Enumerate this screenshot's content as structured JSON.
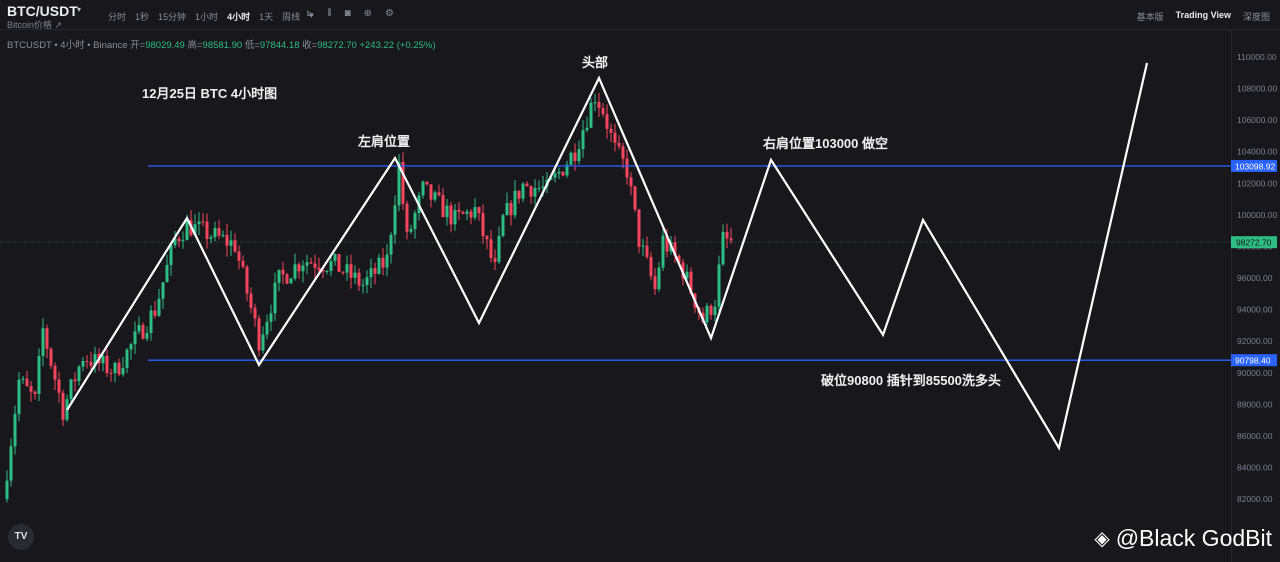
{
  "header": {
    "symbol": "BTC/USDT",
    "subtitle": "Bitcoin价格 ↗",
    "caret": "▾",
    "timeframes": [
      "分时",
      "1秒",
      "15分钟",
      "1小时",
      "4小时",
      "1天",
      "周线",
      "▾"
    ],
    "active_timeframe": "4小时",
    "tools": [
      "⊾",
      "⫴",
      "◙",
      "⊕",
      "⚙"
    ],
    "views": [
      "基本版",
      "Trading View",
      "深度图"
    ],
    "active_view": "Trading View"
  },
  "ohlc": {
    "label": "BTCUSDT • 4小时 • Binance",
    "open_label": "开=",
    "open": "98029.49",
    "high_label": "高=",
    "high": "98581.90",
    "low_label": "低=",
    "low": "97844.18",
    "close_label": "收=",
    "close": "98272.70",
    "change": "+243.22 (+0.25%)"
  },
  "annotations": {
    "title": "12月25日 BTC 4小时图",
    "left_shoulder": "左肩位置",
    "head": "头部",
    "right_shoulder": "右肩位置103000 做空",
    "breakdown": "破位90800 插针到85500洗多头"
  },
  "watermark": "@Black GodBit",
  "tv_logo": "TV",
  "colors": {
    "up": "#2ebd85",
    "down": "#f6465d",
    "level": "#2962ff",
    "pattern": "#ffffff",
    "last": "#2ebd85"
  },
  "chart_data": {
    "type": "candlestick",
    "title": "12月25日 BTC 4小时图",
    "ylim": [
      80000,
      111000
    ],
    "yticks": [
      82000,
      84000,
      86000,
      88000,
      90000,
      92000,
      94000,
      96000,
      98000,
      100000,
      102000,
      104000,
      106000,
      108000,
      110000
    ],
    "ytick_labels": [
      "82000.00",
      "84000.00",
      "86000.00",
      "88000.00",
      "90000.00",
      "92000.00",
      "94000.00",
      "96000.00",
      "98000.00",
      "100000.00",
      "102000.00",
      "104000.00",
      "106000.00",
      "108000.00",
      "110000.00"
    ],
    "levels": [
      {
        "value": 103098.92,
        "label": "103098.92"
      },
      {
        "value": 90798.4,
        "label": "90798.40"
      }
    ],
    "last_price": {
      "value": 98272.7,
      "label": "98272.70"
    },
    "price_path_bar_index": [
      0,
      4,
      8,
      10,
      15,
      20,
      28,
      33,
      38,
      43,
      46,
      58,
      64,
      69,
      75,
      83,
      90,
      96,
      99,
      101,
      105,
      113,
      118,
      123,
      125,
      130,
      136,
      143,
      148,
      150,
      153,
      156,
      159,
      163,
      165,
      170,
      175,
      178,
      180,
      182
    ],
    "price_path": [
      82000,
      89500,
      88230,
      92710,
      87640,
      91050,
      90100,
      92080,
      93980,
      98410,
      99360,
      98100,
      92080,
      95880,
      97150,
      96830,
      95560,
      97150,
      103160,
      98410,
      101580,
      99680,
      100310,
      96510,
      99680,
      101900,
      101580,
      104110,
      107600,
      106640,
      104110,
      102840,
      98410,
      95240,
      98410,
      96510,
      93340,
      94610,
      98410,
      98272
    ],
    "pattern_bar_index": [
      16,
      46,
      64,
      98,
      119,
      149,
      177,
      192,
      220,
      230,
      264,
      286
    ],
    "pattern_prices": [
      87640,
      99800,
      90500,
      103600,
      93150,
      108670,
      92200,
      103480,
      92400,
      99680,
      85240,
      109620
    ]
  }
}
